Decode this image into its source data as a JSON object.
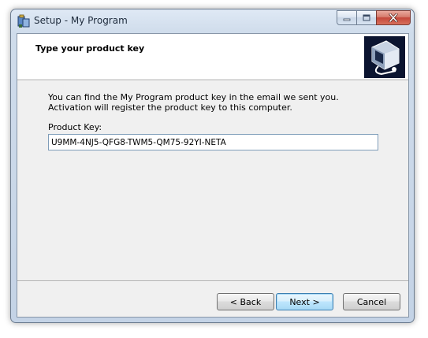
{
  "window": {
    "title": "Setup - My Program"
  },
  "header": {
    "title": "Type your product key"
  },
  "body": {
    "description": "You can find the My Program product key in the email we sent you. Activation will register the product key to this computer.",
    "product_key_label": "Product Key:",
    "product_key_value": "U9MM-4NJ5-QFG8-TWM5-QM75-92YI-NETA"
  },
  "buttons": {
    "back": "< Back",
    "next": "Next >",
    "cancel": "Cancel"
  },
  "icons": {
    "app": "setup-installer-icon",
    "header": "installer-computer-icon",
    "minimize": "minimize-icon",
    "maximize": "maximize-icon",
    "close": "close-icon"
  },
  "colors": {
    "header_image_bg": "#0b1430",
    "close_button": "#c4473a",
    "default_button_border": "#3c7fb1"
  }
}
